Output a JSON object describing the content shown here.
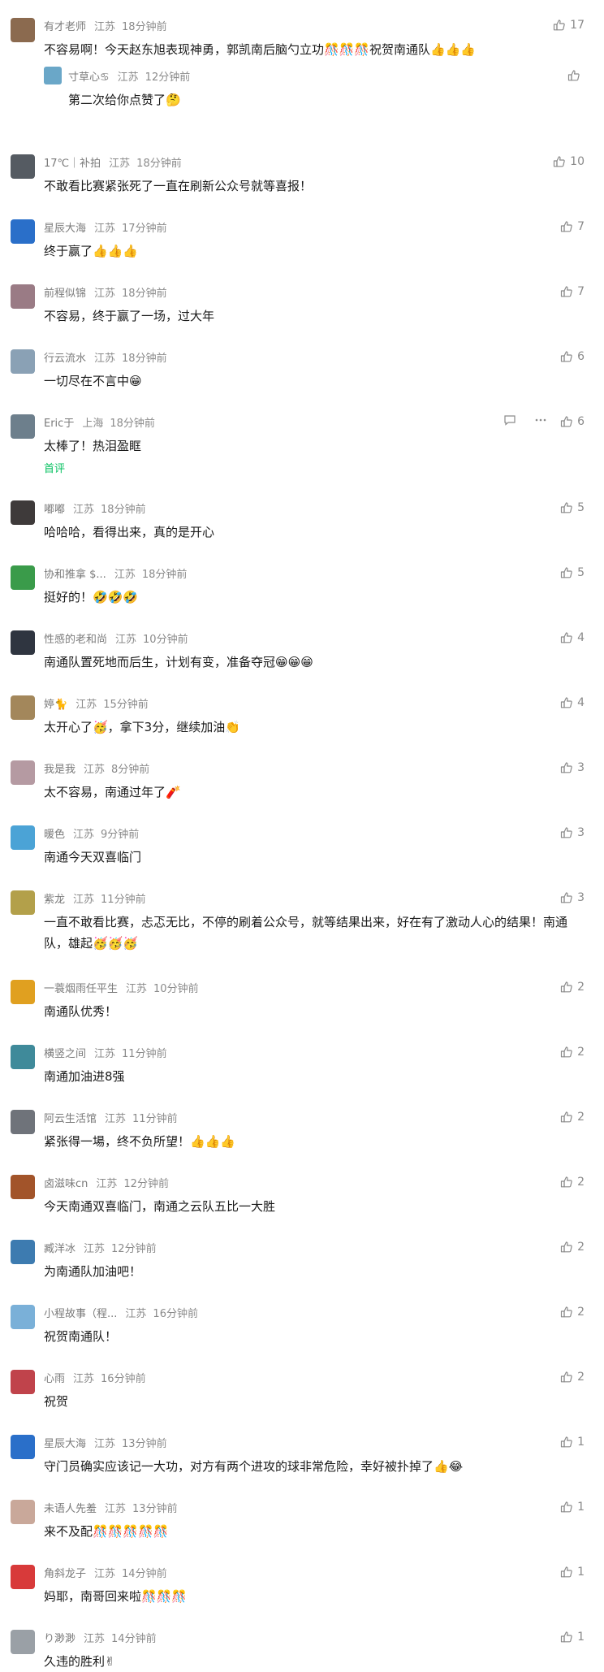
{
  "colors": {
    "like_gray": "#8a8a8a",
    "tag_green": "#07c160",
    "text": "#1a1a1a"
  },
  "comments": [
    {
      "nick": "有才老师",
      "loc": "江苏",
      "time": "18分钟前",
      "likes": "17",
      "text": "不容易啊！今天赵东旭表现神勇，郭凯南后脑勺立功🎊🎊🎊祝贺南通队👍👍👍",
      "avatar": "#8b6a4f",
      "reply": {
        "nick": "寸草心♋",
        "loc": "江苏",
        "time": "12分钟前",
        "likes": "",
        "text": "第二次给你点赞了🤔",
        "avatar": "#6aa7c8"
      }
    },
    {
      "nick": "17℃｜补拍",
      "loc": "江苏",
      "time": "18分钟前",
      "likes": "10",
      "text": "不敢看比赛紧张死了一直在刷新公众号就等喜报！",
      "avatar": "#555b62"
    },
    {
      "nick": "星辰大海",
      "loc": "江苏",
      "time": "17分钟前",
      "likes": "7",
      "text": "终于赢了👍👍👍",
      "avatar": "#2a6fc9"
    },
    {
      "nick": "前程似锦",
      "loc": "江苏",
      "time": "18分钟前",
      "likes": "7",
      "text": "不容易，终于赢了一场，过大年",
      "avatar": "#9a7b85"
    },
    {
      "nick": "行云流水",
      "loc": "江苏",
      "time": "18分钟前",
      "likes": "6",
      "text": "一切尽在不言中😁",
      "avatar": "#8aa1b5"
    },
    {
      "nick": "Eric于",
      "loc": "上海",
      "time": "18分钟前",
      "likes": "6",
      "text": "太棒了！热泪盈眶",
      "tag": "首评",
      "extra": true,
      "avatar": "#6d7f8c"
    },
    {
      "nick": "嘟嘟",
      "loc": "江苏",
      "time": "18分钟前",
      "likes": "5",
      "text": "哈哈哈，看得出来，真的是开心",
      "avatar": "#3e3a3a"
    },
    {
      "nick": "协和推拿 $...",
      "loc": "江苏",
      "time": "18分钟前",
      "likes": "5",
      "text": "挺好的！🤣🤣🤣",
      "avatar": "#3a9b4a"
    },
    {
      "nick": "性感的老和尚",
      "loc": "江苏",
      "time": "10分钟前",
      "likes": "4",
      "text": "南通队置死地而后生，计划有变，准备夺冠😁😁😁",
      "avatar": "#2f3540"
    },
    {
      "nick": "婷🐈",
      "loc": "江苏",
      "time": "15分钟前",
      "likes": "4",
      "text": "太开心了🥳，拿下3分，继续加油👏",
      "avatar": "#a3875b"
    },
    {
      "nick": "我是我",
      "loc": "江苏",
      "time": "8分钟前",
      "likes": "3",
      "text": "太不容易，南通过年了🧨",
      "avatar": "#b59aa2"
    },
    {
      "nick": "暖色",
      "loc": "江苏",
      "time": "9分钟前",
      "likes": "3",
      "text": "南通今天双喜临门",
      "avatar": "#4ba3d6"
    },
    {
      "nick": "紫龙",
      "loc": "江苏",
      "time": "11分钟前",
      "likes": "3",
      "text": "一直不敢看比赛，忐忑无比，不停的刷着公众号，就等结果出来，好在有了激动人心的结果！南通队，雄起🥳🥳🥳",
      "avatar": "#b3a04a"
    },
    {
      "nick": "一蓑烟雨任平生",
      "loc": "江苏",
      "time": "10分钟前",
      "likes": "2",
      "text": "南通队优秀！",
      "avatar": "#e0a020"
    },
    {
      "nick": "横竖之间",
      "loc": "江苏",
      "time": "11分钟前",
      "likes": "2",
      "text": "南通加油进8强",
      "avatar": "#3f8a9a"
    },
    {
      "nick": "阿云生活馆",
      "loc": "江苏",
      "time": "11分钟前",
      "likes": "2",
      "text": "紧张得一場，终不负所望！👍👍👍",
      "avatar": "#6f737a"
    },
    {
      "nick": "卤滋味cn",
      "loc": "江苏",
      "time": "12分钟前",
      "likes": "2",
      "text": "今天南通双喜临门，南通之云队五比一大胜",
      "avatar": "#a2542a"
    },
    {
      "nick": "臧洋冰",
      "loc": "江苏",
      "time": "12分钟前",
      "likes": "2",
      "text": "为南通队加油吧！",
      "avatar": "#3d7bb0"
    },
    {
      "nick": "小程故事（程...",
      "loc": "江苏",
      "time": "16分钟前",
      "likes": "2",
      "text": "祝贺南通队！",
      "avatar": "#7ab0d8"
    },
    {
      "nick": "心雨",
      "loc": "江苏",
      "time": "16分钟前",
      "likes": "2",
      "text": "祝贺",
      "avatar": "#c0434b"
    },
    {
      "nick": "星辰大海",
      "loc": "江苏",
      "time": "13分钟前",
      "likes": "1",
      "text": "守门员确实应该记一大功，对方有两个进攻的球非常危险，幸好被扑掉了👍😂",
      "avatar": "#2a6fc9"
    },
    {
      "nick": "未语人先羞",
      "loc": "江苏",
      "time": "13分钟前",
      "likes": "1",
      "text": "来不及配🎊🎊🎊🎊🎊",
      "avatar": "#c9a89a"
    },
    {
      "nick": "角斜龙子",
      "loc": "江苏",
      "time": "14分钟前",
      "likes": "1",
      "text": "妈耶，南哥回来啦🎊🎊🎊",
      "avatar": "#d83a3a"
    },
    {
      "nick": "り渺渺",
      "loc": "江苏",
      "time": "14分钟前",
      "likes": "1",
      "text": "久违的胜利✌",
      "avatar": "#9aa0a6"
    }
  ]
}
